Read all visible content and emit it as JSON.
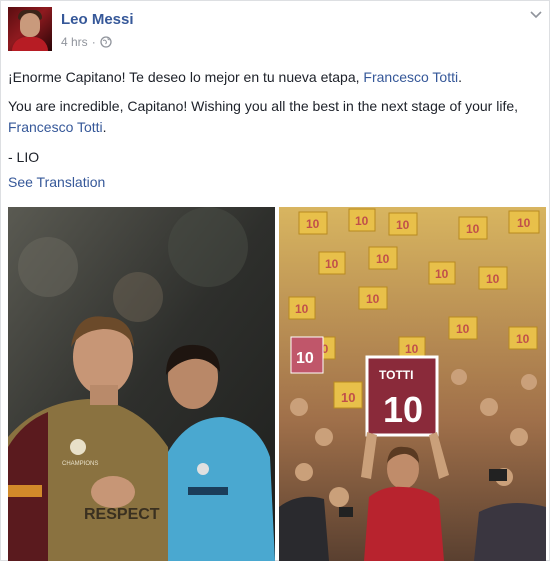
{
  "post": {
    "author": "Leo Messi",
    "time": "4 hrs",
    "separator": "·",
    "icons": {
      "privacy": "globe-icon",
      "menu": "chevron-down-icon"
    },
    "spanish_text": "¡Enorme Capitano! Te deseo lo mejor en tu nueva etapa, ",
    "spanish_link": "Francesco Totti",
    "spanish_end": ".",
    "english_text": "You are incredible, Capitano! Wishing you all the best in the next stage of your life, ",
    "english_link": "Francesco Totti",
    "english_end": ".",
    "signature": "- LIO",
    "see_translation": "See Translation"
  },
  "photos": {
    "left": {
      "jersey_badge": "RESPECT",
      "patch": "CHAMPIONS"
    },
    "right": {
      "sign_name": "TOTTI",
      "sign_number": "10",
      "crowd_number": "10"
    }
  },
  "colors": {
    "link": "#365899",
    "meta": "#90949c",
    "text": "#1d2129"
  }
}
